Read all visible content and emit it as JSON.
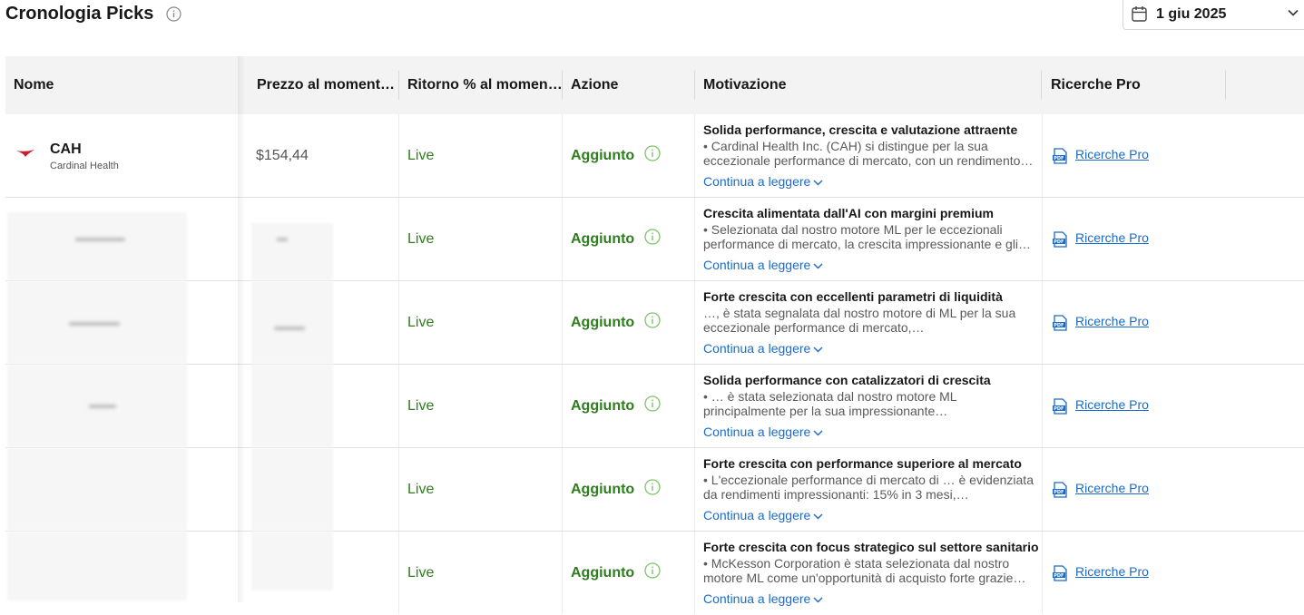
{
  "header": {
    "title": "Cronologia Picks",
    "date_value": "1 giu 2025"
  },
  "table": {
    "columns": [
      "Nome",
      "Prezzo al momento della pick",
      "Ritorno % al momento della pick",
      "Azione",
      "Motivazione",
      "Ricerche Pro"
    ],
    "read_more_label": "Continua a leggere",
    "rows": [
      {
        "ticker": "CAH",
        "company": "Cardinal Health",
        "price": "$154,44",
        "return": "Live",
        "action": "Aggiunto",
        "motivation_title": "Solida performance, crescita e valutazione attraente",
        "motivation_text": "• Cardinal Health Inc. (CAH) si distingue per la sua eccezionale performance di mercato, con un rendimento del",
        "pro_label": "Ricerche Pro"
      },
      {
        "ticker": "",
        "company": "",
        "price": "",
        "return": "Live",
        "action": "Aggiunto",
        "motivation_title": "Crescita alimentata dall'AI con margini premium",
        "motivation_text": "• Selezionata dal nostro motore ML per le eccezionali performance di mercato, la crescita impressionante e gli…",
        "pro_label": "Ricerche Pro"
      },
      {
        "ticker": "",
        "company": "",
        "price": "",
        "return": "Live",
        "action": "Aggiunto",
        "motivation_title": "Forte crescita con eccellenti parametri di liquidità",
        "motivation_text": "…, è stata segnalata dal nostro motore di ML per la sua eccezionale performance di mercato,…",
        "pro_label": "Ricerche Pro"
      },
      {
        "ticker": "",
        "company": "",
        "price": "",
        "return": "Live",
        "action": "Aggiunto",
        "motivation_title": "Solida performance con catalizzatori di crescita",
        "motivation_text": "• … è stata selezionata dal nostro motore ML principalmente per la sua impressionante…",
        "pro_label": "Ricerche Pro"
      },
      {
        "ticker": "",
        "company": "",
        "price": "",
        "return": "Live",
        "action": "Aggiunto",
        "motivation_title": "Forte crescita con performance superiore al mercato",
        "motivation_text": "• L'eccezionale performance di mercato di … è evidenziata da rendimenti impressionanti: 15% in 3 mesi,…",
        "pro_label": "Ricerche Pro"
      },
      {
        "ticker": "",
        "company": "",
        "price": "",
        "return": "Live",
        "action": "Aggiunto",
        "motivation_title": "Forte crescita con focus strategico sul settore sanitario",
        "motivation_text": "• McKesson Corporation è stata selezionata dal nostro motore ML come un'opportunità di acquisto forte grazie a…",
        "pro_label": "Ricerche Pro"
      }
    ]
  },
  "colors": {
    "green": "#2e7d1e",
    "link": "#1a6bc9",
    "header_bg": "#f3f3f3"
  },
  "icons": [
    "info-icon",
    "calendar-icon",
    "chevron-down-icon",
    "info-circle-icon",
    "pdf-icon",
    "company-logo-icon"
  ]
}
